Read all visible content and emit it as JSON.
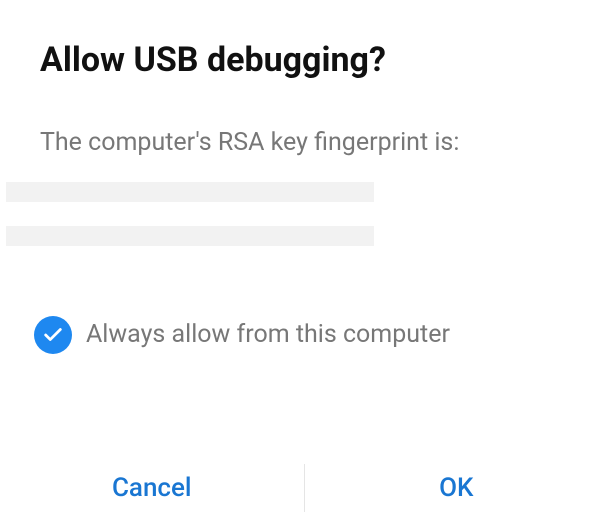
{
  "dialog": {
    "title": "Allow USB debugging?",
    "message": "The computer's RSA key fingerprint is:",
    "checkbox_label": "Always allow from this computer",
    "buttons": {
      "cancel": "Cancel",
      "ok": "OK"
    }
  }
}
